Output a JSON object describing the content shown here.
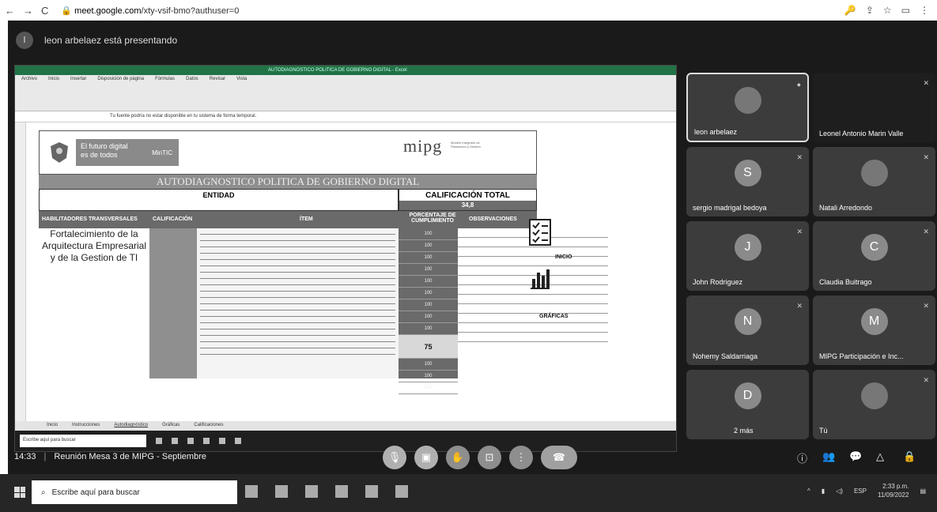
{
  "browser": {
    "url_host": "meet.google.com",
    "url_path": "/xty-vsif-bmo?authuser=0",
    "nav": [
      "←",
      "→",
      "C"
    ],
    "right_icons": [
      "🔑",
      "⇪",
      "☆",
      "▭",
      "⋮"
    ]
  },
  "presenter": {
    "initial": "l",
    "text": "leon arbelaez está presentando"
  },
  "shared_screen": {
    "excel_title": "AUTODIAGNOSTICO POLITICA DE GOBIERNO DIGITAL - Excel",
    "ribbon_tabs": [
      "Archivo",
      "Inicio",
      "Insertar",
      "Disposición de página",
      "Fórmulas",
      "Datos",
      "Revisar",
      "Vista"
    ],
    "formula_text": "Tu fuente podría no estar disponible en tu sistema de forma temporal.",
    "logo_line1": "El futuro digital",
    "logo_line2": "es de todos",
    "logo_right": "MinTIC",
    "mipg_logo": "mipg",
    "mipg_sub": "Modelo Integrado de Planeación y Gestión",
    "sheet_title": "AUTODIAGNOSTICO POLITICA DE GOBIERNO DIGITAL",
    "entidad_label": "ENTIDAD",
    "calificacion_label": "CALIFICACIÓN TOTAL",
    "calificacion_value": "34,8",
    "col_headers": [
      "HABILITADORES TRANSVERSALES",
      "CALIFICACIÓN",
      "ÍTEM",
      "PORCENTAJE DE CUMPLIMIENTO",
      "OBSERVACIONES"
    ],
    "section_name": "Fortalecimiento de la Arquitectura Empresarial y de la Gestion de TI",
    "pct_values": [
      "100",
      "100",
      "100",
      "100",
      "100",
      "100",
      "100",
      "100",
      "100",
      "75",
      "100",
      "100",
      "100"
    ],
    "inicio_label": "INICIO",
    "graficas_label": "GRÁFICAS",
    "sheet_tabs": [
      "Inicio",
      "Instrucciones",
      "Autodiagnóstico",
      "Gráficas",
      "Calificaciones"
    ],
    "inner_search": "Escribe aquí para buscar"
  },
  "participants": [
    {
      "name": "leon arbelaez",
      "initial": "",
      "active": true
    },
    {
      "name": "Leonel Antonio Marin Valle",
      "initial": "",
      "active": false
    },
    {
      "name": "sergio madrigal bedoya",
      "initial": "S",
      "active": false
    },
    {
      "name": "Natali Arredondo",
      "initial": "",
      "active": false
    },
    {
      "name": "John Rodriguez",
      "initial": "J",
      "active": false
    },
    {
      "name": "Claudia Buitrago",
      "initial": "C",
      "active": false
    },
    {
      "name": "Nohemy Saldarriaga",
      "initial": "N",
      "active": false
    },
    {
      "name": "MIPG Participación e Inc...",
      "initial": "M",
      "active": false
    },
    {
      "name": "2 más",
      "initial": "D",
      "active": false
    },
    {
      "name": "Tú",
      "initial": "",
      "active": false
    }
  ],
  "meeting": {
    "time": "14:33",
    "title": "Reunión Mesa 3 de MIPG - Septiembre"
  },
  "taskbar": {
    "search_placeholder": "Escribe aquí para buscar",
    "clock_time": "2:33 p.m.",
    "clock_date": "11/09/2022",
    "lang": "ESP"
  }
}
